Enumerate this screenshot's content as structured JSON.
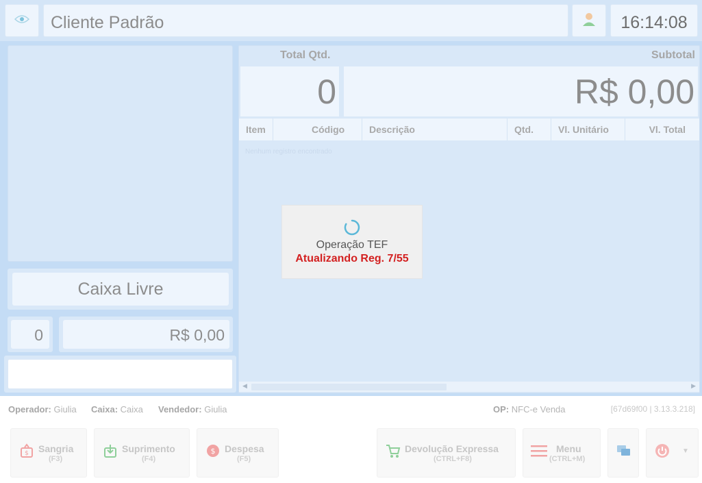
{
  "header": {
    "client_name": "Cliente Padrão",
    "clock": "16:14:08"
  },
  "left": {
    "status": "Caixa Livre",
    "item_count": "0",
    "item_value": "R$ 0,00",
    "input_value": ""
  },
  "summary": {
    "total_qty_label": "Total Qtd.",
    "subtotal_label": "Subtotal",
    "total_qty": "0",
    "subtotal": "R$ 0,00"
  },
  "table": {
    "columns": [
      "Item",
      "Código",
      "Descrição",
      "Qtd.",
      "Vl. Unitário",
      "Vl. Total"
    ],
    "empty_message": "Nenhum registro encontrado"
  },
  "dialog": {
    "title": "Operação TEF",
    "status": "Atualizando Reg. 7/55"
  },
  "info": {
    "operator_label": "Operador:",
    "operator": "Giulia",
    "cashier_label": "Caixa:",
    "cashier": "Caixa",
    "seller_label": "Vendedor:",
    "seller": "Giulia",
    "op_label": "OP:",
    "op": "NFC-e Venda",
    "build": "[67d69f00 | 3.13.3.218]"
  },
  "buttons": {
    "sangria": {
      "label": "Sangria",
      "key": "(F3)",
      "icon": "money-bag-icon"
    },
    "suprimento": {
      "label": "Suprimento",
      "key": "(F4)",
      "icon": "money-in-icon"
    },
    "despesa": {
      "label": "Despesa",
      "key": "(F5)",
      "icon": "coin-icon"
    },
    "devolucao": {
      "label": "Devolução Expressa",
      "key": "(CTRL+F8)",
      "icon": "cart-icon"
    },
    "menu": {
      "label": "Menu",
      "key": "(CTRL+M)",
      "icon": "menu-icon"
    },
    "chat": {
      "icon": "chat-icon"
    },
    "power": {
      "icon": "power-icon"
    }
  },
  "colors": {
    "accent": "#c4dcf5",
    "panel": "#d9e8f8",
    "alert_red": "#d32020",
    "spinner": "#5bb8d8",
    "button_red": "#f1a3a3",
    "button_green": "#8fcf9a"
  }
}
